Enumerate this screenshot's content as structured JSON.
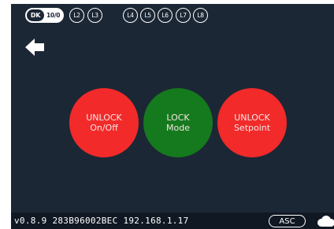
{
  "top_bar": {
    "dk_label": "DK",
    "dk_ratio": "10/0",
    "channels_left": [
      "L2",
      "L3"
    ],
    "channels_right": [
      "L4",
      "L5",
      "L6",
      "L7",
      "L8"
    ]
  },
  "back_icon": "arrow-left-icon",
  "buttons": [
    {
      "line1": "UNLOCK",
      "line2": "On/Off",
      "color": "#f22a2a"
    },
    {
      "line1": "LOCK",
      "line2": "Mode",
      "color": "#157a1d"
    },
    {
      "line1": "UNLOCK",
      "line2": "Setpoint",
      "color": "#f22a2a"
    }
  ],
  "status": {
    "text": "v0.8.9  283B96002BEC  192.168.1.17",
    "mode_label": "ASC",
    "cloud_icon": "cloud-icon"
  },
  "colors": {
    "background": "#1c2735",
    "status_bar": "#101823",
    "unlock": "#f22a2a",
    "lock": "#157a1d"
  }
}
